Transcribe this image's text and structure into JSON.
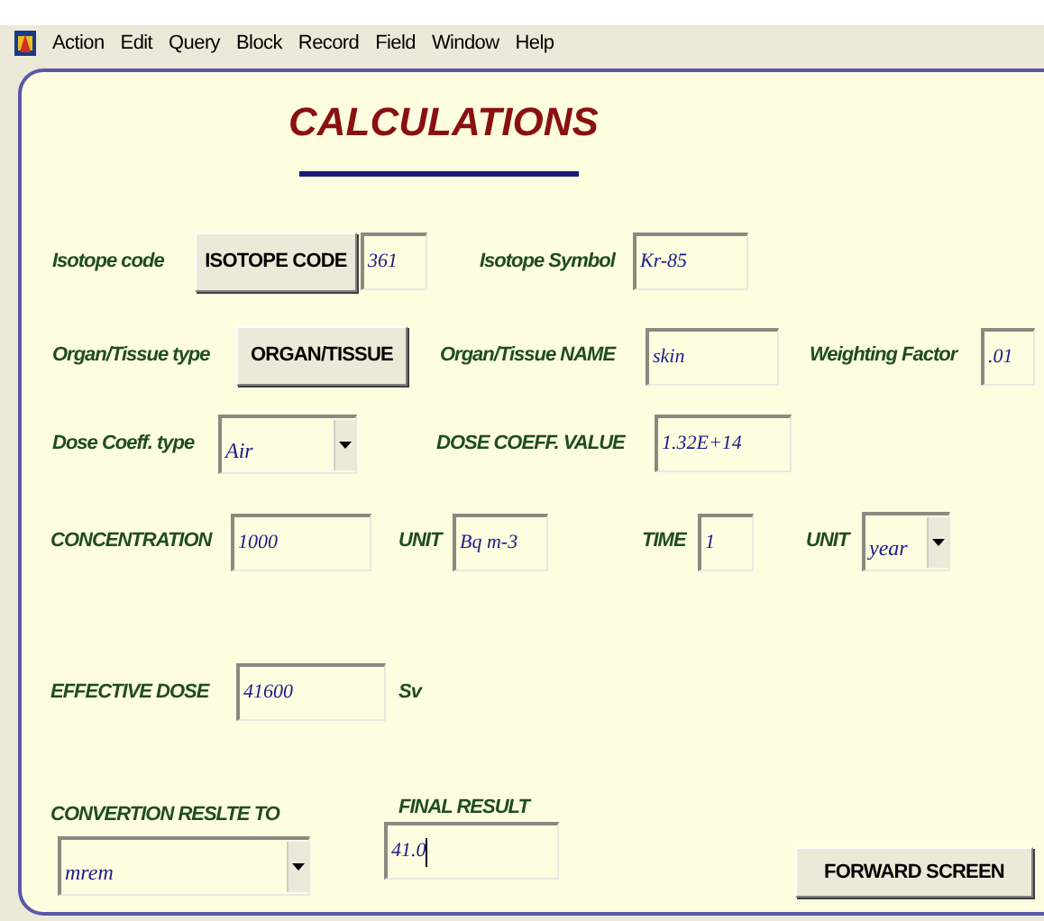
{
  "menu": [
    "Action",
    "Edit",
    "Query",
    "Block",
    "Record",
    "Field",
    "Window",
    "Help"
  ],
  "title": "CALCULATIONS",
  "rows": [
    {
      "items": [
        {
          "kind": "label",
          "text": "Isotope code"
        },
        {
          "kind": "button",
          "text": "ISOTOPE CODE"
        },
        {
          "kind": "field",
          "value": "361"
        },
        {
          "kind": "label",
          "text": "Isotope Symbol"
        },
        {
          "kind": "field",
          "value": "Kr-85"
        }
      ]
    },
    {
      "items": [
        {
          "kind": "label",
          "text": "Organ/Tissue type"
        },
        {
          "kind": "button",
          "text": "ORGAN/TISSUE"
        },
        {
          "kind": "label",
          "text": "Organ/Tissue NAME"
        },
        {
          "kind": "field",
          "value": "skin"
        },
        {
          "kind": "label",
          "text": "Weighting Factor"
        },
        {
          "kind": "field",
          "value": ".01"
        }
      ]
    },
    {
      "items": [
        {
          "kind": "label",
          "text": "Dose Coeff. type"
        },
        {
          "kind": "select",
          "value": "Air"
        },
        {
          "kind": "label",
          "text": "DOSE COEFF. VALUE"
        },
        {
          "kind": "field",
          "value": "1.32E+14"
        }
      ]
    },
    {
      "items": [
        {
          "kind": "label",
          "text": "CONCENTRATION"
        },
        {
          "kind": "field",
          "value": "1000"
        },
        {
          "kind": "label",
          "text": "UNIT"
        },
        {
          "kind": "field",
          "value": "Bq m-3"
        },
        {
          "kind": "label",
          "text": "TIME"
        },
        {
          "kind": "field",
          "value": "1"
        },
        {
          "kind": "label",
          "text": "UNIT"
        },
        {
          "kind": "select",
          "value": "year"
        }
      ]
    },
    {
      "items": [
        {
          "kind": "label",
          "text": "EFFECTIVE DOSE"
        },
        {
          "kind": "field",
          "value": "41600"
        },
        {
          "kind": "label",
          "text": "Sv"
        }
      ]
    },
    {
      "items": [
        {
          "kind": "select",
          "label": "CONVERTION RESLTE TO",
          "value": "mrem"
        },
        {
          "kind": "field",
          "label": "FINAL RESULT",
          "value": "41.0",
          "focused": true
        },
        {
          "kind": "button",
          "text": "FORWARD SCREEN"
        }
      ]
    }
  ]
}
